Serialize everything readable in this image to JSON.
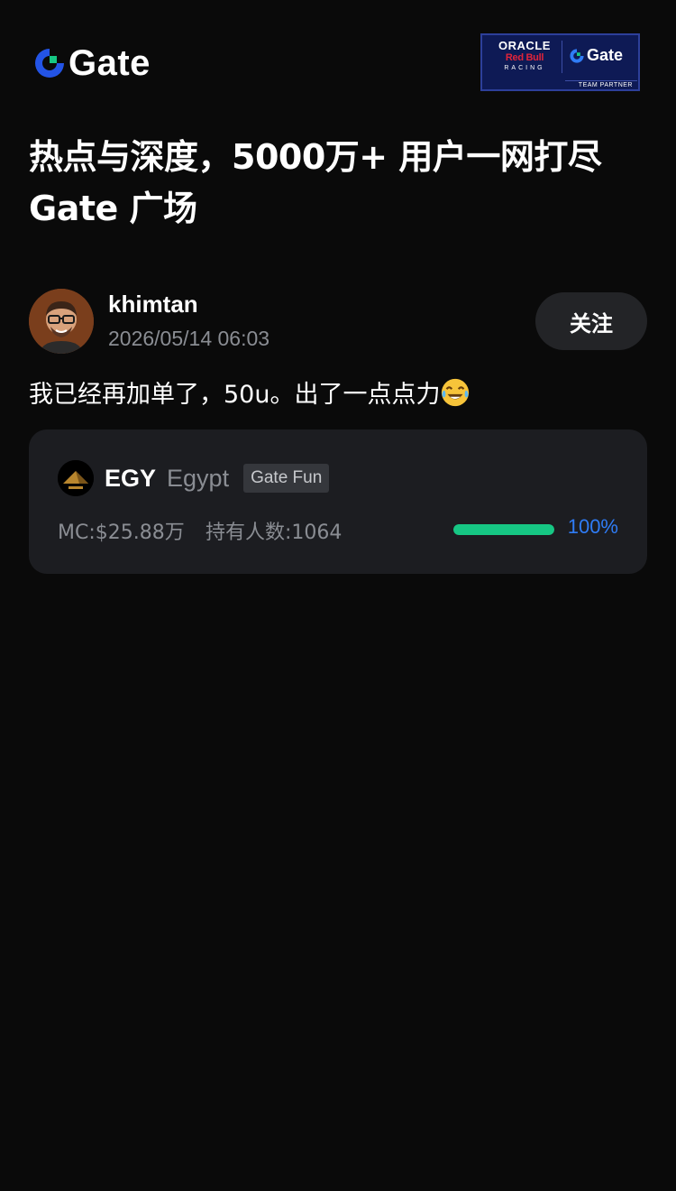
{
  "header": {
    "logo_text": "Gate",
    "partner": {
      "oracle": "ORACLE",
      "redbull": "Red Bull",
      "racing": "RACING",
      "gate": "Gate",
      "team_partner": "TEAM PARTNER"
    }
  },
  "headline": {
    "line1": "热点与深度，5000万+ 用户一网打尽",
    "line2": "Gate 广场"
  },
  "post": {
    "author": "khimtan",
    "time": "2026/05/14 06:03",
    "follow_label": "关注",
    "text": "我已经再加单了，50u。出了一点点力",
    "emoji": "joy-emoji"
  },
  "token": {
    "symbol": "EGY",
    "name": "Egypt",
    "tag": "Gate Fun",
    "market_cap": "MC:$25.88万",
    "holders": "持有人数:1064",
    "progress_percent": 100,
    "progress_label": "100%",
    "colors": {
      "progress": "#16c784",
      "progress_label": "#2f7cf6"
    }
  },
  "colors": {
    "background": "#0a0a0a",
    "brand_blue": "#2354e6",
    "brand_green": "#16c784"
  }
}
